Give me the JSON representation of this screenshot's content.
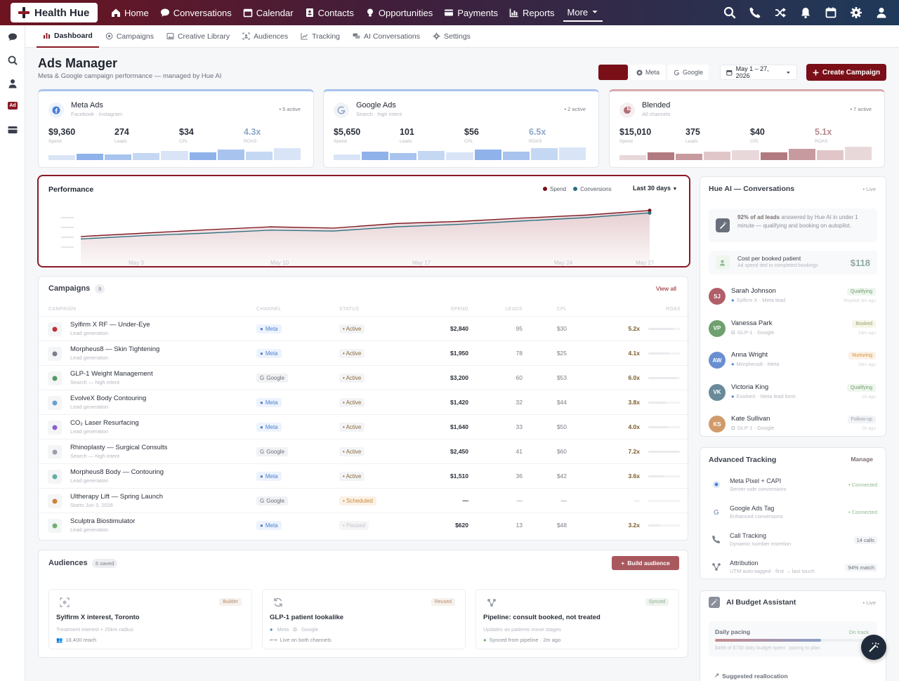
{
  "brand": {
    "name": "Health Hue"
  },
  "nav": {
    "items": [
      {
        "label": "Home",
        "icon": "home-icon"
      },
      {
        "label": "Conversations",
        "icon": "chat-icon"
      },
      {
        "label": "Calendar",
        "icon": "calendar-icon"
      },
      {
        "label": "Contacts",
        "icon": "contacts-icon"
      },
      {
        "label": "Opportunities",
        "icon": "lightbulb-icon"
      },
      {
        "label": "Payments",
        "icon": "card-icon"
      },
      {
        "label": "Reports",
        "icon": "chart-icon"
      }
    ],
    "more_label": "More"
  },
  "subnav": {
    "tabs": [
      {
        "label": "Dashboard",
        "active": true
      },
      {
        "label": "Campaigns"
      },
      {
        "label": "Creative Library"
      },
      {
        "label": "Audiences"
      },
      {
        "label": "Tracking"
      },
      {
        "label": "AI Conversations"
      },
      {
        "label": "Settings"
      }
    ]
  },
  "header": {
    "title": "Ads Manager",
    "subtitle": "Meta & Google campaign performance — managed by Hue AI",
    "filters": [
      "Meta",
      "Google"
    ],
    "date_range": "May 1 – 27, 2026",
    "create_label": "Create Campaign"
  },
  "platforms": [
    {
      "name": "Meta Ads",
      "sub": "Facebook · Instagram",
      "badge": "• 5 active",
      "color": "#4a7fd1",
      "metrics": [
        {
          "value": "$9,360",
          "label": "Spend"
        },
        {
          "value": "274",
          "label": "Leads"
        },
        {
          "value": "$34",
          "label": "CPL"
        },
        {
          "value": "4.3x",
          "label": "ROAS"
        }
      ],
      "bars": [
        0.35,
        0.45,
        0.4,
        0.5,
        0.65,
        0.55,
        0.75,
        0.6,
        0.85
      ]
    },
    {
      "name": "Google Ads",
      "sub": "Search · high intent",
      "badge": "• 2 active",
      "color": "#4a7fd1",
      "metrics": [
        {
          "value": "$5,650",
          "label": "Spend"
        },
        {
          "value": "101",
          "label": "Leads"
        },
        {
          "value": "$56",
          "label": "CPL"
        },
        {
          "value": "6.5x",
          "label": "ROAS"
        }
      ],
      "bars": [
        0.4,
        0.6,
        0.5,
        0.65,
        0.55,
        0.75,
        0.6,
        0.85,
        0.9
      ]
    },
    {
      "name": "Blended",
      "sub": "All channels",
      "badge": "• 7 active",
      "color": "#8b1a24",
      "metrics": [
        {
          "value": "$15,010",
          "label": "Spend"
        },
        {
          "value": "375",
          "label": "Leads"
        },
        {
          "value": "$40",
          "label": "CPL"
        },
        {
          "value": "5.1x",
          "label": "ROAS"
        }
      ],
      "bars": [
        0.35,
        0.55,
        0.45,
        0.6,
        0.7,
        0.55,
        0.8,
        0.7,
        0.95
      ]
    }
  ],
  "performance": {
    "title": "Performance",
    "legend": [
      {
        "name": "Spend",
        "color": "#7a0f18"
      },
      {
        "name": "Conversions",
        "color": "#2a6f7f"
      }
    ],
    "range_label": "Last 30 days"
  },
  "chart_data": {
    "type": "line",
    "x": [
      "May 1",
      "May 4",
      "May 7",
      "May 10",
      "May 13",
      "May 16",
      "May 19",
      "May 22",
      "May 25",
      "May 27"
    ],
    "x_tick_labels": [
      "May 3",
      "May 10",
      "May 17",
      "May 24",
      "May 27"
    ],
    "series": [
      {
        "name": "Spend",
        "values": [
          0.32,
          0.4,
          0.48,
          0.55,
          0.52,
          0.63,
          0.68,
          0.76,
          0.83,
          0.94
        ]
      },
      {
        "name": "Conversions",
        "values": [
          0.26,
          0.34,
          0.4,
          0.47,
          0.45,
          0.55,
          0.61,
          0.69,
          0.77,
          0.88
        ]
      }
    ],
    "ylim": [
      0,
      1
    ],
    "grid": false,
    "legend": "top-right"
  },
  "campaigns": {
    "title": "Campaigns",
    "count": "9",
    "view_all": "View all",
    "columns": [
      "CAMPAIGN",
      "CHANNEL",
      "STATUS",
      "SPEND",
      "LEADS",
      "CPL",
      "ROAS"
    ],
    "rows": [
      {
        "name": "Sylfirm X RF — Under-Eye",
        "sub": "Lead generation",
        "channel": "Meta",
        "status": "Active",
        "spend": "$2,840",
        "leads": "95",
        "cpl": "$30",
        "roas": "5.2x",
        "progress": 0.8,
        "icon": "bolt-icon",
        "icolor": "#c0303a"
      },
      {
        "name": "Morpheus8 — Skin Tightening",
        "sub": "Lead generation",
        "channel": "Meta",
        "status": "Active",
        "spend": "$1,950",
        "leads": "78",
        "cpl": "$25",
        "roas": "4.1x",
        "progress": 0.65,
        "icon": "pulse-icon",
        "icolor": "#7a7f89"
      },
      {
        "name": "GLP-1 Weight Management",
        "sub": "Search — high intent",
        "channel": "Google",
        "status": "Active",
        "spend": "$3,200",
        "leads": "60",
        "cpl": "$53",
        "roas": "6.0x",
        "progress": 0.9,
        "icon": "scale-icon",
        "icolor": "#4f9a5f"
      },
      {
        "name": "EvolveX Body Contouring",
        "sub": "Lead generation",
        "channel": "Meta",
        "status": "Active",
        "spend": "$1,420",
        "leads": "32",
        "cpl": "$44",
        "roas": "3.8x",
        "progress": 0.55,
        "icon": "figure-icon",
        "icolor": "#6a9fd1"
      },
      {
        "name": "CO₂ Laser Resurfacing",
        "sub": "Lead generation",
        "channel": "Meta",
        "status": "Active",
        "spend": "$1,640",
        "leads": "33",
        "cpl": "$50",
        "roas": "4.0x",
        "progress": 0.6,
        "icon": "laser-icon",
        "icolor": "#8a5fd1"
      },
      {
        "name": "Rhinoplasty — Surgical Consults",
        "sub": "Search — high intent",
        "channel": "Google",
        "status": "Active",
        "spend": "$2,450",
        "leads": "41",
        "cpl": "$60",
        "roas": "7.2x",
        "progress": 0.95,
        "icon": "person-icon",
        "icolor": "#9aa0aa"
      },
      {
        "name": "Morpheus8 Body — Contouring",
        "sub": "Lead generation",
        "channel": "Meta",
        "status": "Active",
        "spend": "$1,510",
        "leads": "36",
        "cpl": "$42",
        "roas": "3.6x",
        "progress": 0.5,
        "icon": "body-icon",
        "icolor": "#5fb0a0"
      },
      {
        "name": "Ultherapy Lift — Spring Launch",
        "sub": "Starts Jun 3, 2026",
        "channel": "Google",
        "status": "Scheduled",
        "spend": "—",
        "leads": "—",
        "cpl": "—",
        "roas": "—",
        "progress": 0,
        "icon": "lift-icon",
        "icolor": "#d1803a"
      },
      {
        "name": "Sculptra Biostimulator",
        "sub": "Lead generation",
        "channel": "Meta",
        "status": "Paused",
        "spend": "$620",
        "leads": "13",
        "cpl": "$48",
        "roas": "3.2x",
        "progress": 0.35,
        "icon": "syringe-icon",
        "icolor": "#6fb06f"
      }
    ]
  },
  "audiences": {
    "title": "Audiences",
    "count": "6 saved",
    "build_label": "Build audience",
    "cards": [
      {
        "title": "Sylfirm X interest, Toronto",
        "desc": "Treatment interest + 25km radius",
        "foot": "18,400 reach",
        "badge": "Builder",
        "icon": "target-icon"
      },
      {
        "title": "GLP-1 patient lookalike",
        "desc_meta": "Meta",
        "desc_google": "Google",
        "foot": "Live on both channels",
        "badge": "Reused",
        "icon": "refresh-icon"
      },
      {
        "title": "Pipeline: consult booked, not treated",
        "desc": "Updates as patients move stages",
        "foot": "Synced from pipeline · 2m ago",
        "badge": "Synced",
        "icon": "pipeline-icon"
      }
    ]
  },
  "hue_ai": {
    "title": "Hue AI — Conversations",
    "live": "• Live",
    "insight_bold": "92% of ad leads",
    "insight_rest": " answered by Hue AI in under 1 minute — qualifying and booking on autopilot.",
    "cpb_title": "Cost per booked patient",
    "cpb_sub": "Ad spend tied to completed bookings",
    "cpb_value": "$118",
    "conversations": [
      {
        "initials": "SJ",
        "name": "Sarah Johnson",
        "source": "Sylfirm X · Meta lead",
        "channel": "meta",
        "status": "Qualifying",
        "time": "Replied 2m ago",
        "color": "#b05f68",
        "bbg": "#eef6ee",
        "bfg": "#6fa06f"
      },
      {
        "initials": "VP",
        "name": "Vanessa Park",
        "source": "GLP-1 · Google",
        "channel": "google",
        "status": "Booked",
        "time": "14m ago",
        "color": "#6fa06f",
        "bbg": "#f6f6e8",
        "bfg": "#9aa06a"
      },
      {
        "initials": "AW",
        "name": "Anna Wright",
        "source": "Morpheus8 · Meta",
        "channel": "meta",
        "status": "Nurturing",
        "time": "28m ago",
        "color": "#6a8fd1",
        "bbg": "#fbf1e6",
        "bfg": "#d1903a"
      },
      {
        "initials": "VK",
        "name": "Victoria King",
        "source": "EvolveX · Meta lead form",
        "channel": "meta",
        "status": "Qualifying",
        "time": "1h ago",
        "color": "#6a8a9a",
        "bbg": "#eef6ee",
        "bfg": "#6fa06f"
      },
      {
        "initials": "KS",
        "name": "Kate Sullivan",
        "source": "GLP-1 · Google",
        "channel": "google",
        "status": "Follow-up",
        "time": "2h ago",
        "color": "#d19a6a",
        "bbg": "#f1f3f6",
        "bfg": "#9aa0aa"
      }
    ]
  },
  "tracking": {
    "title": "Advanced Tracking",
    "manage": "Manage",
    "items": [
      {
        "name": "Meta Pixel + CAPI",
        "sub": "Server-side conversions",
        "value": "• Connected",
        "icon": "meta-icon"
      },
      {
        "name": "Google Ads Tag",
        "sub": "Enhanced conversions",
        "value": "• Connected",
        "icon": "google-icon"
      },
      {
        "name": "Call Tracking",
        "sub": "Dynamic number insertion",
        "value": "14 calls",
        "icon": "phone-icon"
      },
      {
        "name": "Attribution",
        "sub": "UTM auto-tagged · first → last touch",
        "value": "94% match",
        "icon": "attribution-icon"
      }
    ]
  },
  "budget": {
    "title": "AI Budget Assistant",
    "live": "• Live",
    "pacing_label": "Daily pacing",
    "pacing_status": "On track",
    "pacing_fraction": 0.68,
    "pacing_detail": "$498 of $730 daily budget spent · pacing to plan",
    "realloc_label": "Suggested reallocation"
  }
}
